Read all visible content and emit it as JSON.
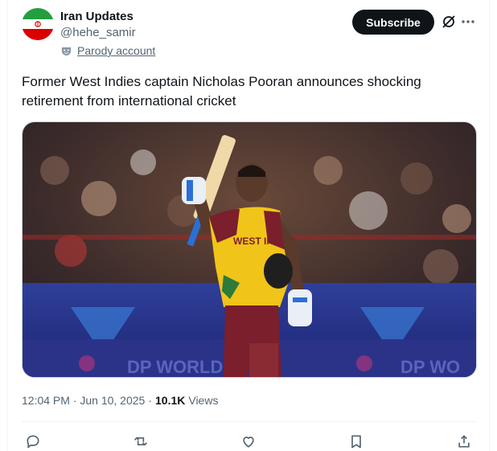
{
  "author": {
    "name": "Iran Updates",
    "handle": "@hehe_samir",
    "parody_label": "Parody account",
    "avatar_icon": "iran-flag-icon"
  },
  "header": {
    "subscribe_label": "Subscribe",
    "grok_icon": "grok-icon",
    "more_icon": "more-icon"
  },
  "tweet": {
    "text": "Former West Indies captain Nicholas Pooran announces shocking retirement from international cricket",
    "media": {
      "description_icon": "cricket-photo",
      "jersey_text": "WEST INDIES"
    }
  },
  "meta": {
    "timestamp": "12:04 PM · Jun 10, 2025",
    "separator": "·",
    "views_count": "10.1K",
    "views_label": "Views"
  },
  "actions": [
    {
      "name": "reply",
      "icon": "reply-icon"
    },
    {
      "name": "repost",
      "icon": "repost-icon"
    },
    {
      "name": "like",
      "icon": "like-icon"
    },
    {
      "name": "bookmark",
      "icon": "bookmark-icon"
    },
    {
      "name": "share",
      "icon": "share-icon"
    }
  ],
  "colors": {
    "text_primary": "#0f1419",
    "text_secondary": "#536471",
    "border": "#eff3f4",
    "flag_green": "#239f40",
    "flag_red": "#da0000",
    "jersey_maroon": "#7a1f2b",
    "jersey_gold": "#f0c419"
  }
}
